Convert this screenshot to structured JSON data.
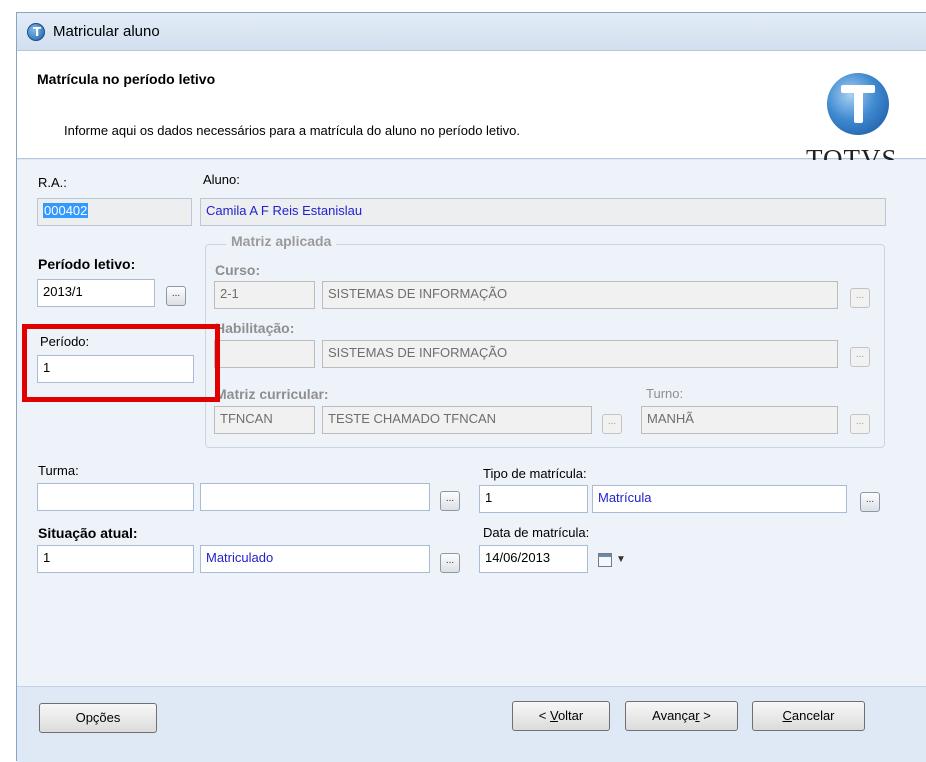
{
  "window": {
    "title": "Matricular aluno"
  },
  "header": {
    "title": "Matrícula no período letivo",
    "description": "Informe aqui os dados necessários para a matrícula do aluno no período letivo.",
    "logo_text": "TOTVS"
  },
  "form": {
    "ra": {
      "label": "R.A.:",
      "value": "000402"
    },
    "aluno": {
      "label": "Aluno:",
      "value": "Camila A F Reis Estanislau"
    },
    "periodo_letivo": {
      "label": "Período letivo:",
      "value": "2013/1"
    },
    "periodo": {
      "label": "Período:",
      "value": "1"
    },
    "matriz": {
      "group_label": "Matriz aplicada",
      "curso": {
        "label": "Curso:",
        "code": "2-1",
        "name": "SISTEMAS DE INFORMAÇÃO"
      },
      "habilitacao": {
        "label": "Habilitação:",
        "code": "",
        "name": "SISTEMAS DE INFORMAÇÃO"
      },
      "matriz_curricular": {
        "label": "Matriz curricular:",
        "code": "TFNCAN",
        "name": "TESTE CHAMADO TFNCAN"
      },
      "turno": {
        "label": "Turno:",
        "value": "MANHÃ"
      }
    },
    "turma": {
      "label": "Turma:",
      "code": "",
      "name": ""
    },
    "tipo_matricula": {
      "label": "Tipo de matrícula:",
      "code": "1",
      "name": "Matrícula"
    },
    "situacao_atual": {
      "label": "Situação atual:",
      "code": "1",
      "name": "Matriculado"
    },
    "data_matricula": {
      "label": "Data de matrícula:",
      "value": "14/06/2013"
    },
    "ellipsis": "..."
  },
  "footer": {
    "opcoes": "Opções",
    "voltar_prefix": "< ",
    "voltar_key": "V",
    "voltar_rest": "oltar",
    "avancar_main": "Avança",
    "avancar_key": "r",
    "avancar_suffix": " >",
    "cancelar_key": "C",
    "cancelar_rest": "ancelar"
  },
  "colors": {
    "highlight": "#e00000",
    "link_text": "#2222cc",
    "window_bg": "#dfe9f6"
  }
}
